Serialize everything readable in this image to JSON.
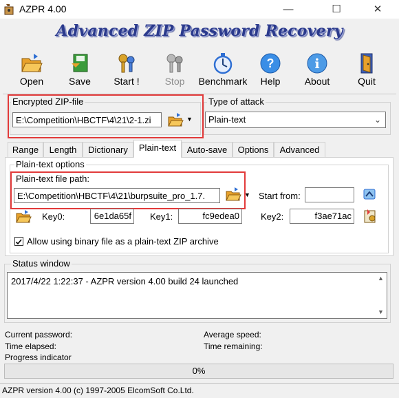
{
  "window": {
    "title": "AZPR 4.00",
    "minimize": "—",
    "maximize": "☐",
    "close": "✕"
  },
  "banner": "Advanced ZIP Password Recovery",
  "toolbar": {
    "open": "Open",
    "save": "Save",
    "start": "Start !",
    "stop": "Stop",
    "benchmark": "Benchmark",
    "help": "Help",
    "about": "About",
    "quit": "Quit"
  },
  "encrypted_zip": {
    "label": "Encrypted ZIP-file",
    "path": "E:\\Competition\\HBCTF\\4\\21\\2-1.zi"
  },
  "attack": {
    "label": "Type of attack",
    "selected": "Plain-text"
  },
  "tabs": [
    "Range",
    "Length",
    "Dictionary",
    "Plain-text",
    "Auto-save",
    "Options",
    "Advanced"
  ],
  "plaintext": {
    "options_label": "Plain-text options",
    "path_label": "Plain-text file path:",
    "path": "E:\\Competition\\HBCTF\\4\\21\\burpsuite_pro_1.7.",
    "start_from_label": "Start from:",
    "start_from": "",
    "key0_label": "Key0:",
    "key0": "6e1da65f",
    "key1_label": "Key1:",
    "key1": "fc9edea0",
    "key2_label": "Key2:",
    "key2": "f3ae71ac",
    "allow_binary_label": "Allow using binary file as a plain-text ZIP archive",
    "allow_binary_checked": true
  },
  "status": {
    "label": "Status window",
    "lines": [
      "2017/4/22 1:22:37 - AZPR version 4.00 build 24 launched"
    ]
  },
  "info": {
    "current_password_label": "Current password:",
    "time_elapsed_label": "Time elapsed:",
    "progress_label": "Progress indicator",
    "average_speed_label": "Average speed:",
    "time_remaining_label": "Time remaining:",
    "progress_text": "0%",
    "progress_value": 0
  },
  "statusbar": "AZPR version 4.00 (c) 1997-2005 ElcomSoft Co.Ltd.",
  "colors": {
    "highlight_red": "#e23a3a",
    "banner_blue": "#2b3a8c"
  }
}
